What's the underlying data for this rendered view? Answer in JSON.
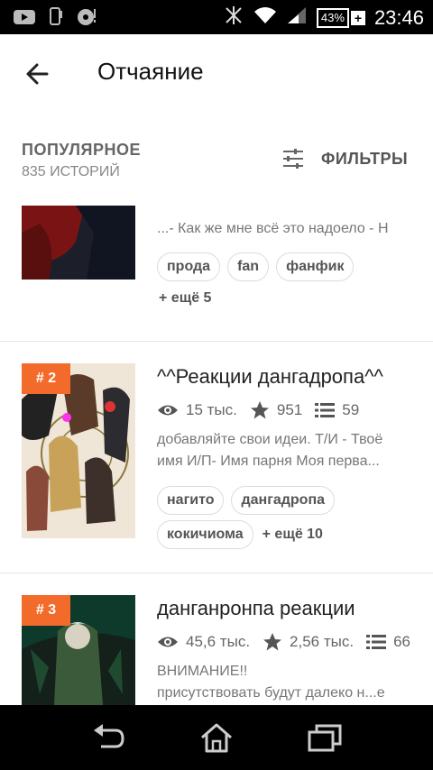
{
  "status_bar": {
    "time": "23:46",
    "battery": "43%"
  },
  "appbar": {
    "title": "Отчаяние"
  },
  "filterbar": {
    "sort_label": "ПОПУЛЯРНОЕ",
    "count_label": "835 ИСТОРИЙ",
    "filters_label": "ФИЛЬТРЫ"
  },
  "stories": [
    {
      "description": "...- Как же мне всё это надоело - Н",
      "tags": [
        "прода",
        "fan",
        "фанфик"
      ],
      "more": "+ ещё 5"
    },
    {
      "rank": "# 2",
      "title": "^^Реакции дангадропа^^",
      "views": "15 тыс.",
      "votes": "951",
      "parts": "59",
      "description_lines": [
        "добавляйте свои идеи. Т/И - Твоё",
        "имя И/П- Имя парня Моя перва..."
      ],
      "tags": [
        "нагито",
        "дангадропа",
        "кокичиома"
      ],
      "more": "+ ещё 10"
    },
    {
      "rank": "# 3",
      "title": "данганронпа реакции",
      "views": "45,6 тыс.",
      "votes": "2,56 тыс.",
      "parts": "66",
      "description_lines": [
        "ВНИМАНИЕ!!",
        "присутствовать будут далеко н...е"
      ]
    }
  ],
  "colors": {
    "accent": "#f26b2a",
    "status_bar": "#000000",
    "nav_bar": "#000000"
  }
}
